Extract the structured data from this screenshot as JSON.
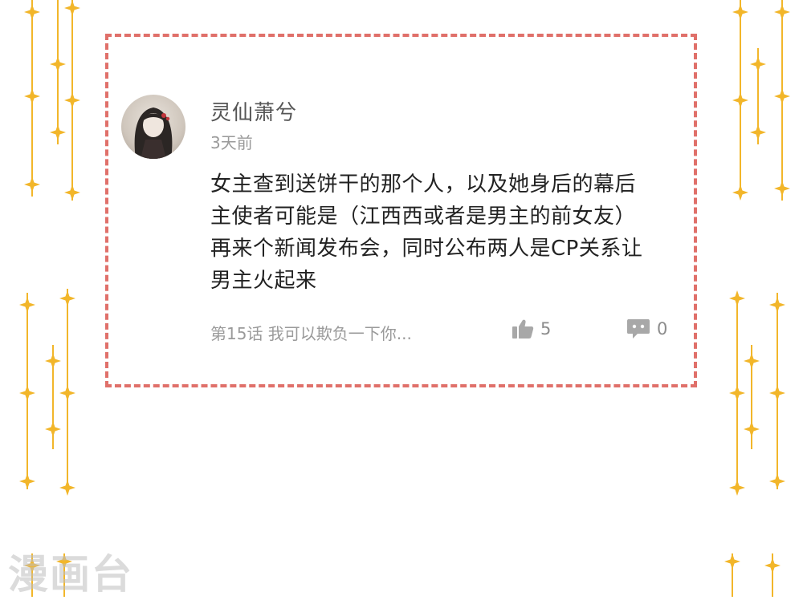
{
  "comment": {
    "username": "灵仙萧兮",
    "time": "3天前",
    "lines": [
      "女主查到送饼干的那个人，以及她身后的幕后",
      "主使者可能是（江西西或者是男主的前女友）",
      "再来个新闻发布会，同时公布两人是CP关系让",
      "男主火起来"
    ],
    "chapter": "第15话 我可以欺负一下你...",
    "likes": "5",
    "replies": "0"
  },
  "watermark": "漫画台",
  "colors": {
    "border": "#e0706a",
    "sparkle": "#f2b62a",
    "muted_text": "#9a9a9a"
  },
  "icons": {
    "like": "thumbs-up-icon",
    "reply": "speech-bubble-icon"
  }
}
